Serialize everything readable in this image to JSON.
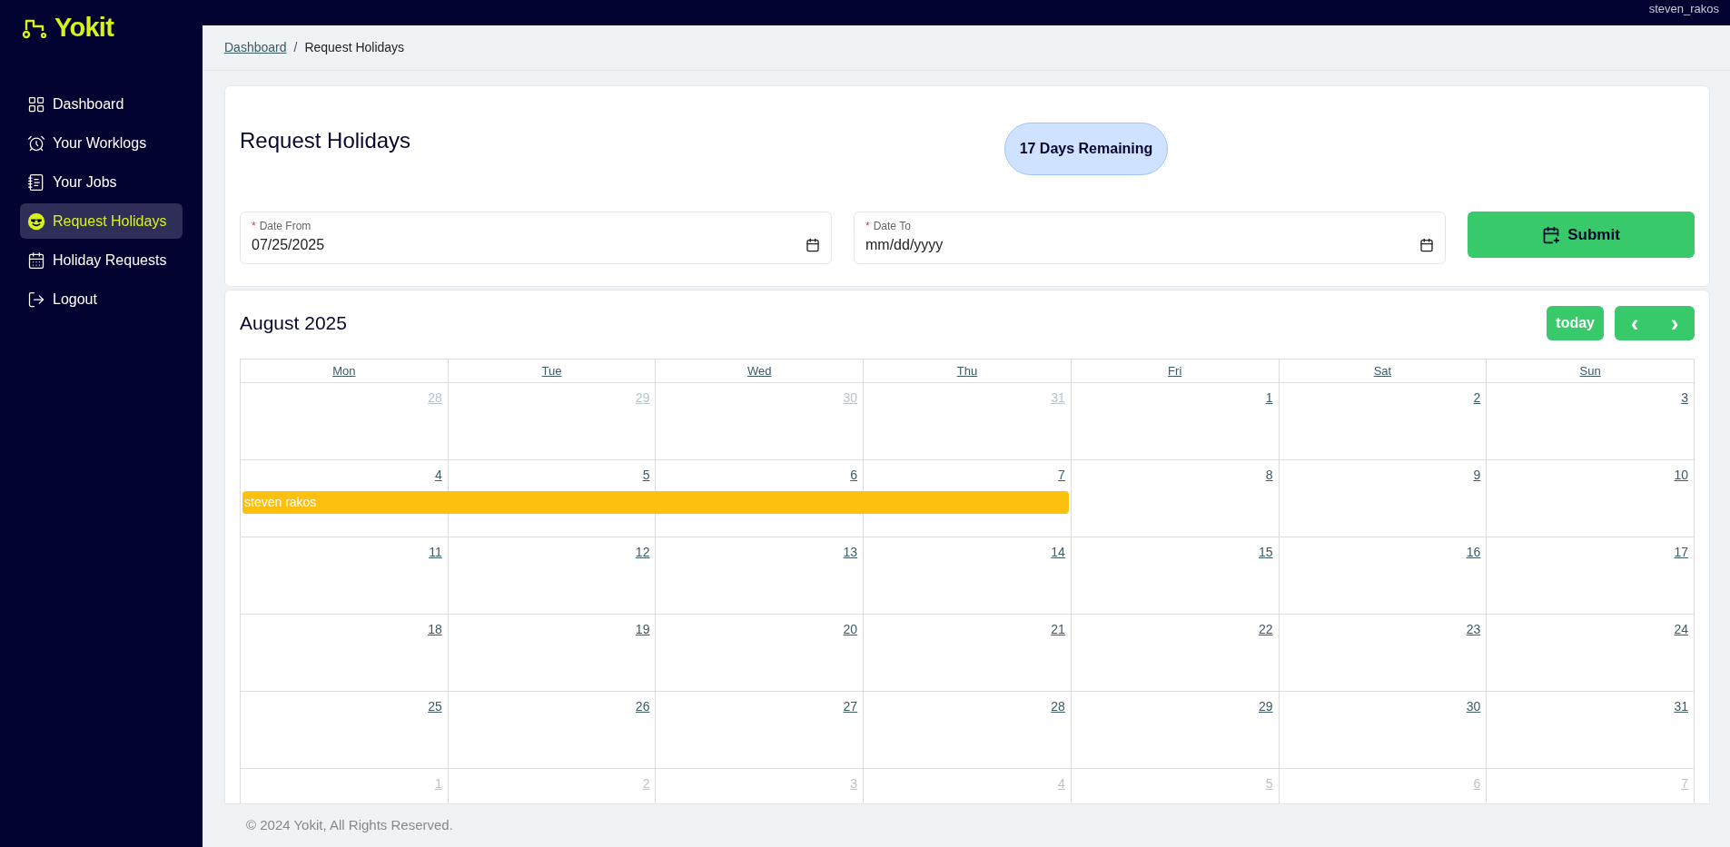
{
  "topbar": {
    "user": "steven_rakos"
  },
  "brand": {
    "name": "Yokit"
  },
  "sidebar": {
    "items": [
      {
        "label": "Dashboard",
        "selected": false
      },
      {
        "label": "Your Worklogs",
        "selected": false
      },
      {
        "label": "Your Jobs",
        "selected": false
      },
      {
        "label": "Request Holidays",
        "selected": true
      },
      {
        "label": "Holiday Requests",
        "selected": false
      },
      {
        "label": "Logout",
        "selected": false
      }
    ]
  },
  "breadcrumb": {
    "separator": "/",
    "items": [
      {
        "label": "Dashboard",
        "link": true
      },
      {
        "label": "Request Holidays",
        "link": false
      }
    ]
  },
  "form": {
    "title": "Request Holidays",
    "remaining": "17 Days Remaining",
    "fields": [
      {
        "label": "Date From",
        "required_mark": "*",
        "value": "07/25/2025"
      },
      {
        "label": "Date To",
        "required_mark": "*",
        "placeholder": "mm/dd/yyyy"
      }
    ],
    "submit": "Submit"
  },
  "calendar": {
    "title": "August 2025",
    "today": "today",
    "prev": "‹",
    "next": "›",
    "weekdays": [
      "Mon",
      "Tue",
      "Wed",
      "Thu",
      "Fri",
      "Sat",
      "Sun"
    ],
    "weeks": [
      {
        "days": [
          {
            "num": "28",
            "other_month": true
          },
          {
            "num": "29",
            "other_month": true
          },
          {
            "num": "30",
            "other_month": true
          },
          {
            "num": "31",
            "other_month": true
          },
          {
            "num": "1",
            "other_month": false
          },
          {
            "num": "2",
            "other_month": false
          },
          {
            "num": "3",
            "other_month": false
          }
        ]
      },
      {
        "days": [
          {
            "num": "4",
            "other_month": false,
            "in_event": true
          },
          {
            "num": "5",
            "other_month": false,
            "in_event": true
          },
          {
            "num": "6",
            "other_month": false,
            "in_event": true
          },
          {
            "num": "7",
            "other_month": false,
            "in_event": true
          },
          {
            "num": "8",
            "other_month": false,
            "in_event": false
          },
          {
            "num": "9",
            "other_month": false,
            "in_event": false
          },
          {
            "num": "10",
            "other_month": false,
            "in_event": false
          }
        ],
        "event": {
          "label": "steven rakos",
          "color": "#fdc00f"
        }
      },
      {
        "days": [
          {
            "num": "11",
            "other_month": false
          },
          {
            "num": "12",
            "other_month": false
          },
          {
            "num": "13",
            "other_month": false
          },
          {
            "num": "14",
            "other_month": false
          },
          {
            "num": "15",
            "other_month": false
          },
          {
            "num": "16",
            "other_month": false
          },
          {
            "num": "17",
            "other_month": false
          }
        ]
      },
      {
        "days": [
          {
            "num": "18",
            "other_month": false
          },
          {
            "num": "19",
            "other_month": false
          },
          {
            "num": "20",
            "other_month": false
          },
          {
            "num": "21",
            "other_month": false
          },
          {
            "num": "22",
            "other_month": false
          },
          {
            "num": "23",
            "other_month": false
          },
          {
            "num": "24",
            "other_month": false
          }
        ]
      },
      {
        "days": [
          {
            "num": "25",
            "other_month": false
          },
          {
            "num": "26",
            "other_month": false
          },
          {
            "num": "27",
            "other_month": false
          },
          {
            "num": "28",
            "other_month": false
          },
          {
            "num": "29",
            "other_month": false
          },
          {
            "num": "30",
            "other_month": false
          },
          {
            "num": "31",
            "other_month": false
          }
        ]
      },
      {
        "days": [
          {
            "num": "1",
            "other_month": true
          },
          {
            "num": "2",
            "other_month": true
          },
          {
            "num": "3",
            "other_month": true
          },
          {
            "num": "4",
            "other_month": true
          },
          {
            "num": "5",
            "other_month": true
          },
          {
            "num": "6",
            "other_month": true
          },
          {
            "num": "7",
            "other_month": true
          }
        ]
      }
    ]
  },
  "footer": "© 2024 Yokit, All Rights Reserved."
}
